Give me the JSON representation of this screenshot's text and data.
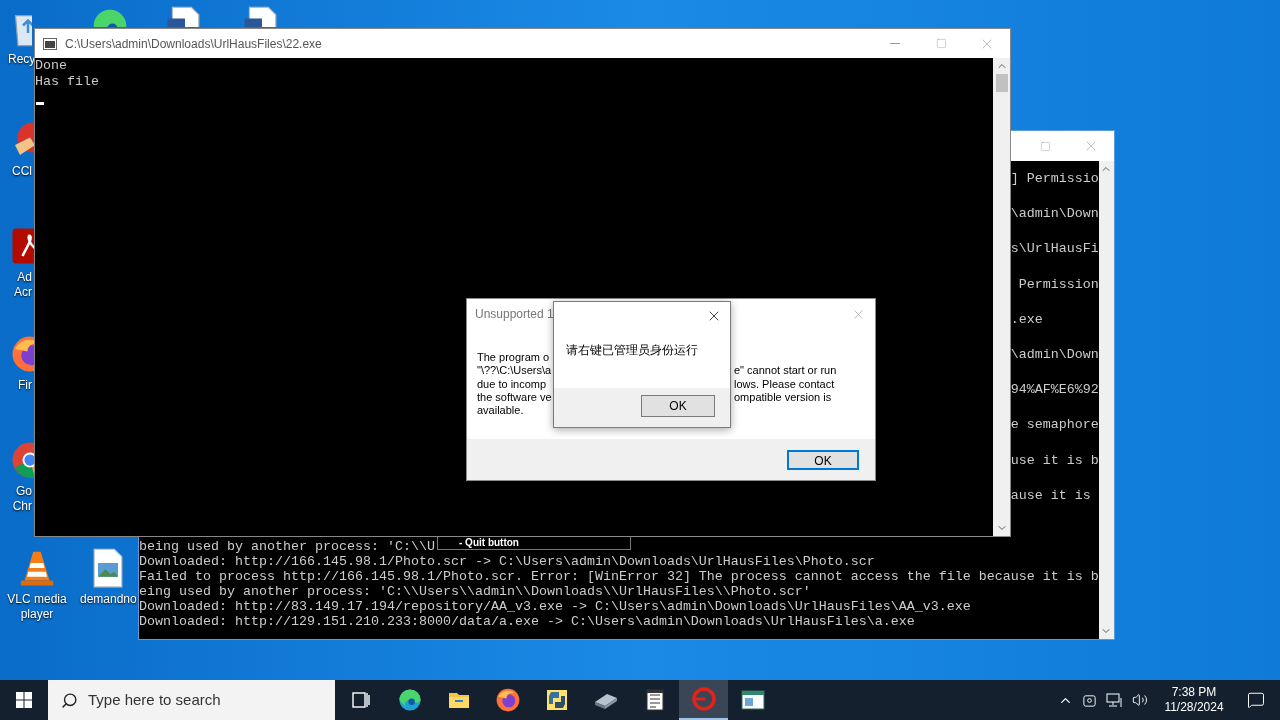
{
  "desktop_icons": [
    {
      "kind": "recycle-bin",
      "label": "Recy"
    },
    {
      "kind": "cleaner",
      "label": "CCl"
    },
    {
      "kind": "acrobat",
      "label": "Ad Acr"
    },
    {
      "kind": "firefox",
      "label": "Fir"
    },
    {
      "kind": "chrome",
      "label": "Go Chr"
    },
    {
      "kind": "vlc",
      "label": "VLC media player"
    },
    {
      "kind": "image-file",
      "label": "demandno"
    }
  ],
  "covered_icons": [
    {
      "kind": "edge"
    },
    {
      "kind": "document"
    },
    {
      "kind": "document"
    }
  ],
  "back_console": {
    "right_fragments": [
      "] Permissio",
      "\\admin\\Down",
      "s\\UrlHausFi",
      " Permission",
      ".exe",
      "\\admin\\Down",
      "94%AF%E6%92",
      "e semaphore",
      "use it is b",
      "ause it is"
    ],
    "bottom_lines": [
      "being used by another process: 'C:\\\\U",
      "Downloaded: http://166.145.98.1/Photo.scr -> C:\\Users\\admin\\Downloads\\UrlHausFiles\\Photo.scr",
      "Failed to process http://166.145.98.1/Photo.scr. Error: [WinError 32] The process cannot access the file because it is b",
      "eing used by another process: 'C:\\\\Users\\\\admin\\\\Downloads\\\\UrlHausFiles\\\\Photo.scr'",
      "Downloaded: http://83.149.17.194/repository/AA_v3.exe -> C:\\Users\\admin\\Downloads\\UrlHausFiles\\AA_v3.exe",
      "Downloaded: http://129.151.210.233:8000/data/a.exe -> C:\\Users\\admin\\Downloads\\UrlHausFiles\\a.exe"
    ]
  },
  "quit_tip": "- Quit button",
  "console": {
    "title": "C:\\Users\\admin\\Downloads\\UrlHausFiles\\22.exe",
    "lines": [
      "Done",
      "Has file"
    ]
  },
  "compat_dialog": {
    "title": "Unsupported 1",
    "left_fragments": [
      "The program o",
      "\"\\??\\C:\\Users\\a",
      "due to incomp",
      "the software ve",
      "available."
    ],
    "right_fragments": [
      "e\" cannot start or run",
      "lows. Please contact",
      "ompatible version is"
    ],
    "button": "OK"
  },
  "message_box": {
    "message": "请右键已管理员身份运行",
    "button": "OK"
  },
  "taskbar": {
    "search": {
      "placeholder": "Type here to search"
    },
    "apps": [
      {
        "kind": "task-view",
        "selected": false
      },
      {
        "kind": "edge",
        "selected": false
      },
      {
        "kind": "folder",
        "selected": false
      },
      {
        "kind": "firefox",
        "selected": false
      },
      {
        "kind": "python",
        "selected": false
      },
      {
        "kind": "device",
        "selected": false
      },
      {
        "kind": "notepad",
        "selected": false
      },
      {
        "kind": "red-ring",
        "selected": true
      },
      {
        "kind": "window",
        "selected": false
      }
    ],
    "time": "7:38 PM",
    "date": "11/28/2024"
  }
}
